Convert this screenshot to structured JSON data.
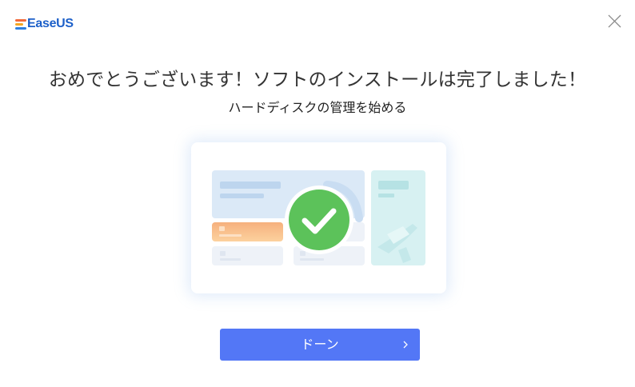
{
  "app": {
    "brand": "EaseUS",
    "colors": {
      "brand_blue": "#1d60c9",
      "logo_bar_top": "#f26a3b",
      "logo_bar_mid": "#f5a623",
      "logo_bar_low": "#2f7fe0",
      "check_green": "#5cc25a",
      "button_blue": "#5377f6"
    }
  },
  "header": {
    "close_icon": "close-icon"
  },
  "main": {
    "title": "おめでとうございます！ソフトのインストールは完了しました！",
    "subtitle": "ハードディスクの管理を始める",
    "illustration_icon": "check-circle-icon"
  },
  "footer": {
    "done_label": "ドーン",
    "done_icon": "chevron-right-icon"
  }
}
